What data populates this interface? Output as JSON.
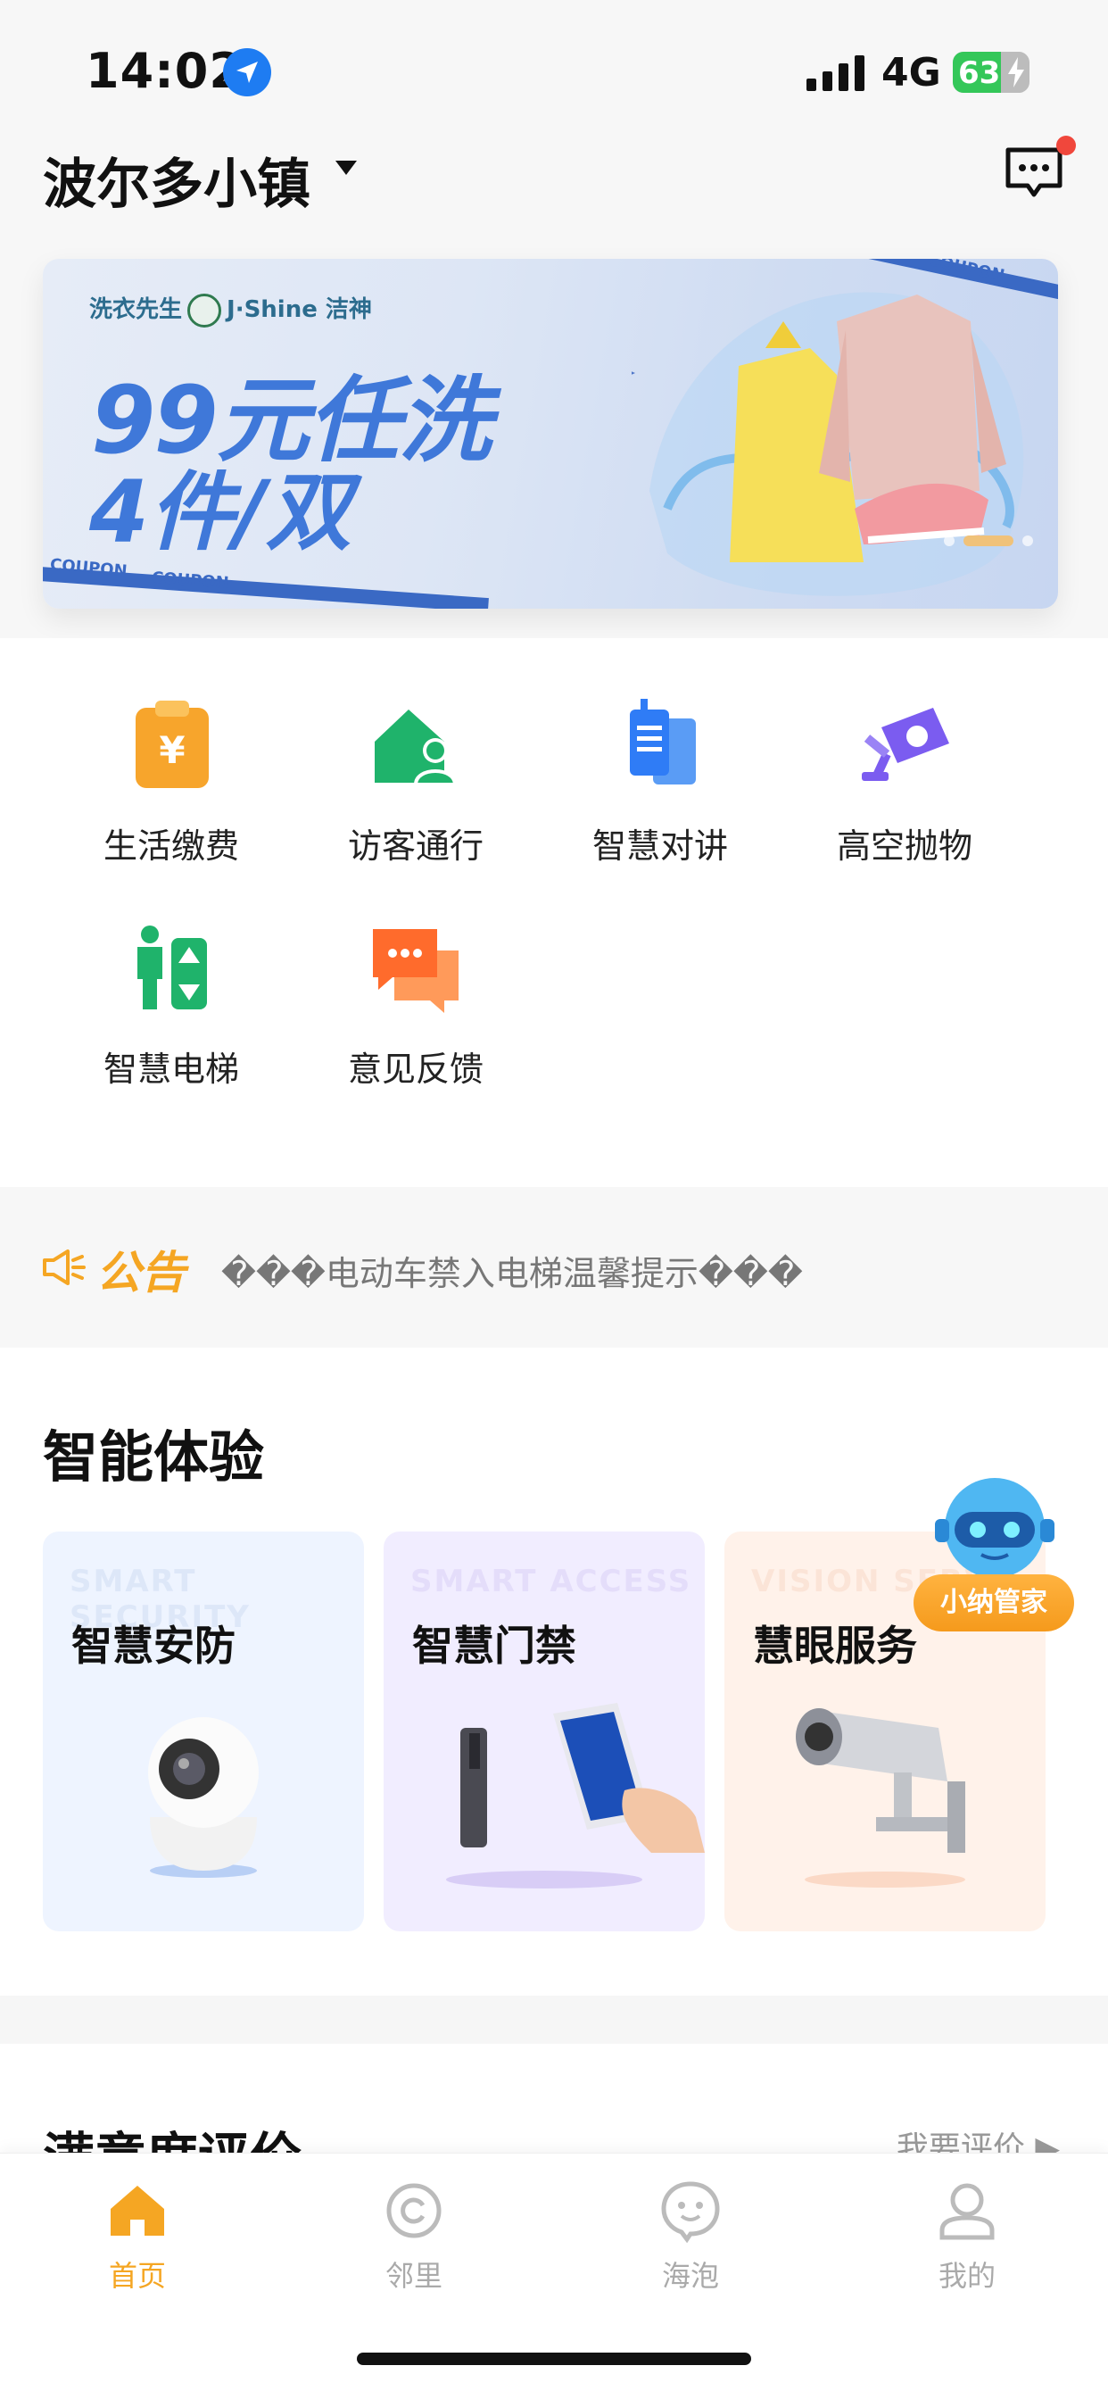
{
  "status_bar": {
    "time": "14:02",
    "network": "4G",
    "battery": "63",
    "battery_level": 0.63
  },
  "header": {
    "community": "波尔多小镇"
  },
  "banner": {
    "brand": "洗衣先生",
    "brand2": "J·Shine 洁神",
    "headline1": "99元任洗",
    "headline2": "4件/双",
    "coupon": "COUPON"
  },
  "services": [
    {
      "label": "生活缴费",
      "icon": "payment-icon"
    },
    {
      "label": "访客通行",
      "icon": "visitor-icon"
    },
    {
      "label": "智慧对讲",
      "icon": "intercom-icon"
    },
    {
      "label": "高空抛物",
      "icon": "camera-icon"
    },
    {
      "label": "智慧电梯",
      "icon": "elevator-icon"
    },
    {
      "label": "意见反馈",
      "icon": "feedback-icon"
    }
  ],
  "notice": {
    "tag": "公告",
    "text": "���电动车禁入电梯温馨提示���"
  },
  "smart": {
    "title": "智能体验",
    "cards": [
      {
        "label": "智慧安防",
        "bg_text": "SMART SECURITY"
      },
      {
        "label": "智慧门禁",
        "bg_text": "SMART ACCESS"
      },
      {
        "label": "慧眼服务",
        "bg_text": "VISION SERV"
      }
    ],
    "assistant": "小纳管家"
  },
  "satisfaction": {
    "title": "满意度评价",
    "link": "我要评价"
  },
  "tabs": [
    {
      "label": "首页",
      "icon": "home-icon",
      "active": true
    },
    {
      "label": "邻里",
      "icon": "neighbor-icon",
      "active": false
    },
    {
      "label": "海泡",
      "icon": "chat-icon",
      "active": false
    },
    {
      "label": "我的",
      "icon": "profile-icon",
      "active": false
    }
  ],
  "colors": {
    "accent": "#f5a623",
    "green": "#1fb36b",
    "blue": "#2f7cf6",
    "orange": "#ff7a2e"
  }
}
